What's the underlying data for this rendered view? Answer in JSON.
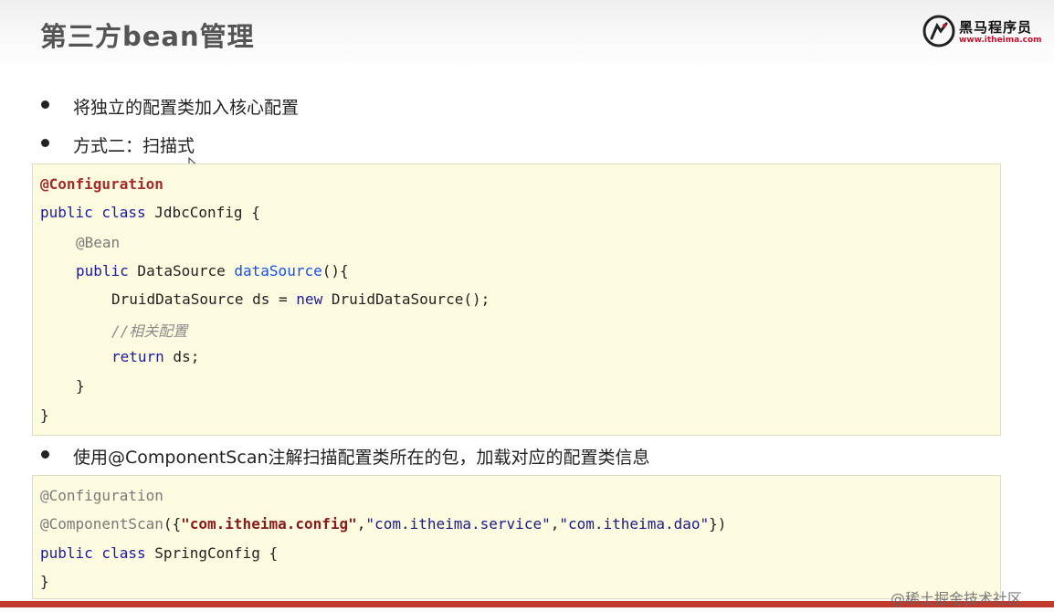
{
  "header": {
    "title": "第三方bean管理",
    "logo_name": "黑马程序员",
    "logo_url": "www.itheima.com"
  },
  "bullets": [
    "将独立的配置类加入核心配置",
    "方式二：扫描式",
    "使用@ComponentScan注解扫描配置类所在的包，加载对应的配置类信息"
  ],
  "code1": {
    "line1": "@Configuration",
    "line2_kw": "public class",
    "line2_name": " JdbcConfig {",
    "line3": "@Bean",
    "line4_kw": "public",
    "line4_type": " DataSource ",
    "line4_method": "dataSource",
    "line4_end": "(){",
    "line5_a": "DruidDataSource ds = ",
    "line5_kw": "new",
    "line5_b": " DruidDataSource();",
    "line6": "//相关配置",
    "line7_kw": "return",
    "line7_b": " ds;",
    "line8": "}",
    "line9": "}"
  },
  "code2": {
    "line1": "@Configuration",
    "line2_ann": "@ComponentScan",
    "line2_open": "({",
    "line2_s1": "\"com.itheima.config\"",
    "line2_sep1": ",",
    "line2_s2": "\"com.itheima.service\"",
    "line2_sep2": ",",
    "line2_s3": "\"com.itheima.dao\"",
    "line2_close": "})",
    "line3_kw": "public class",
    "line3_name": " SpringConfig {",
    "line4": "}"
  },
  "watermark": "@稀土掘金技术社区",
  "colors": {
    "accent_red": "#c0392b",
    "code_bg": "#fdfbe0",
    "keyword": "#1a1aa6"
  }
}
